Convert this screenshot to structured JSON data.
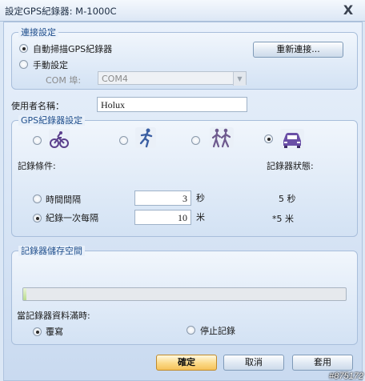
{
  "window": {
    "title": "設定GPS紀錄器: M-1000C",
    "close_glyph": "X"
  },
  "connection": {
    "title": "連接設定",
    "auto_scan_label": "自動掃描GPS紀錄器",
    "manual_label": "手動設定",
    "com_port_label": "COM 埠:",
    "com_port_value": "COM4",
    "reconnect_button": "重新連接..."
  },
  "username": {
    "label": "使用者名稱：",
    "value": "Holux"
  },
  "gps_settings": {
    "title": "GPS紀錄器設定",
    "modes": [
      {
        "icon": "bicycle-icon",
        "selected": false
      },
      {
        "icon": "runner-icon",
        "selected": false
      },
      {
        "icon": "hikers-icon",
        "selected": false
      },
      {
        "icon": "car-icon",
        "selected": true
      }
    ],
    "record_condition_label": "記錄條件:",
    "logger_status_label": "記錄器狀態:",
    "time_interval_label": "時間間隔",
    "time_interval_value": "3",
    "time_unit": "秒",
    "time_status": "5  秒",
    "distance_label": "紀錄一次每隔",
    "distance_value": "10",
    "distance_unit": "米",
    "distance_status": "*5  米",
    "selected_condition": "distance"
  },
  "storage": {
    "title": "記錄器儲存空間",
    "used_fraction": 0.01,
    "full_label": "當記錄器資料滿時:",
    "overwrite_label": "覆寫",
    "stop_label": "停止記錄",
    "selected": "overwrite"
  },
  "buttons": {
    "ok": "確定",
    "cancel": "取消",
    "apply": "套用"
  },
  "watermark": "#875172",
  "colors": {
    "group_title": "#1f4e8c",
    "primary_button": "#f5c25a",
    "background": "#dbe7f5"
  }
}
